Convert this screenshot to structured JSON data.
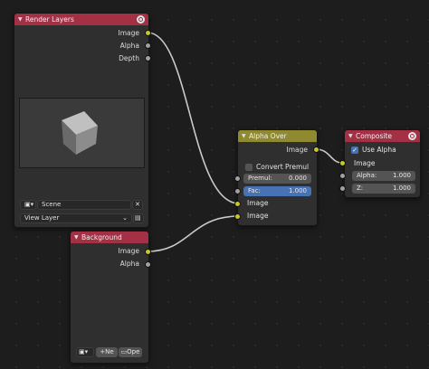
{
  "render_layers": {
    "title": "Render Layers",
    "outputs": [
      "Image",
      "Alpha",
      "Depth"
    ],
    "scene_value": "Scene",
    "view_layer_value": "View Layer"
  },
  "background_node": {
    "title": "Background",
    "outputs": [
      "Image",
      "Alpha"
    ],
    "new_label": "Ne",
    "open_label": "Ope"
  },
  "alpha_over": {
    "title": "Alpha Over",
    "output": "Image",
    "convert_premul_label": "Convert Premul",
    "premul_label": "Premul:",
    "premul_value": "0.000",
    "fac_label": "Fac:",
    "fac_value": "1.000",
    "inputs": [
      "Image",
      "Image"
    ]
  },
  "composite": {
    "title": "Composite",
    "use_alpha_label": "Use Alpha",
    "use_alpha_checked": true,
    "image_label": "Image",
    "alpha_label": "Alpha:",
    "alpha_value": "1.000",
    "z_label": "Z:",
    "z_value": "1.000"
  },
  "colors": {
    "input_header": "#a33044",
    "mix_header": "#8f8a2f",
    "color_socket": "#c7c729",
    "value_socket": "#a1a1a1",
    "selected_field": "#4772b3"
  }
}
